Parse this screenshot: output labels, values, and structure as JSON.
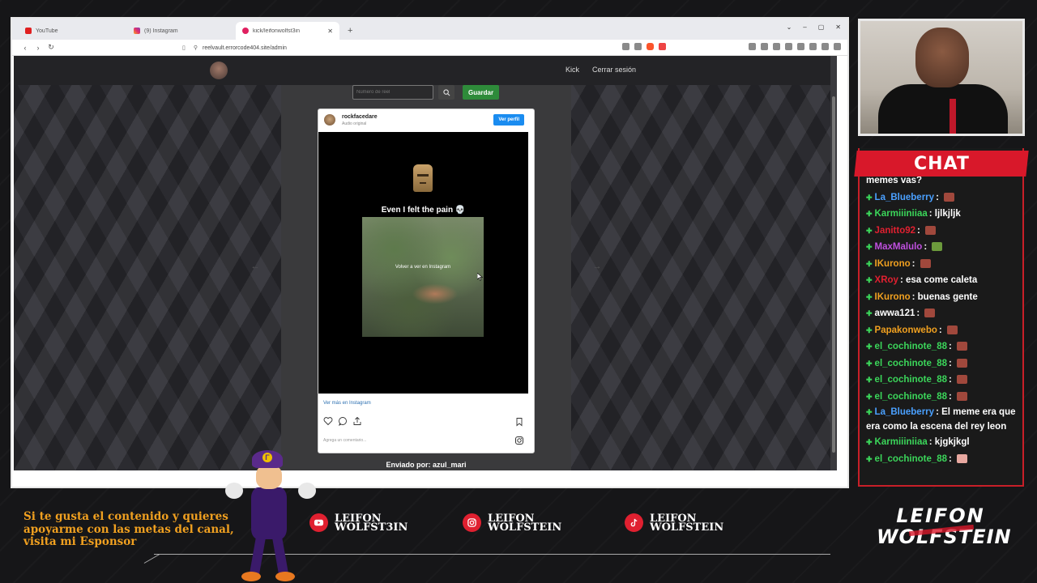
{
  "browser": {
    "tabs": [
      {
        "label": "YouTube",
        "favicon": "youtube-icon"
      },
      {
        "label": "(9) Instagram",
        "favicon": "instagram-icon"
      },
      {
        "label": "kick/leifonwolfst3in",
        "favicon": "kick-icon",
        "active": true
      }
    ],
    "new_tab_label": "+",
    "url": "reelvault.errorcode404.site/admin"
  },
  "site": {
    "nav": {
      "kick": "Kick",
      "logout": "Cerrar sesión"
    },
    "reel_input_placeholder": "Número de reel",
    "save_label": "Guardar",
    "sent_by": "Enviado por: azul_mari"
  },
  "instagram": {
    "username": "rockfacedare",
    "audio": "Audio original",
    "follow_label": "Ver perfil",
    "caption": "Even I felt the pain 💀",
    "video_overlay": "Volver a ver en Instagram",
    "more_label": "Ver más en Instagram",
    "comment_placeholder": "Agrega un comentario..."
  },
  "chat": {
    "title": "CHAT",
    "messages": [
      {
        "user": "",
        "text": "memes vas?",
        "color": "#ffffff"
      },
      {
        "user": "La_Blueberry",
        "text": "",
        "color": "#4aa0ff",
        "emote": "brick"
      },
      {
        "user": "Karmiiiniiaa",
        "text": "ljlkjljk",
        "color": "#3bd65a"
      },
      {
        "user": "Janitto92",
        "text": "",
        "color": "#e02030",
        "emote": "brick"
      },
      {
        "user": "MaxMalulo",
        "text": "",
        "color": "#c050e0",
        "emote": "green"
      },
      {
        "user": "IKurono",
        "text": "",
        "color": "#f0a020",
        "emote": "brick"
      },
      {
        "user": "XRoy",
        "text": "esa come caleta",
        "color": "#e02030"
      },
      {
        "user": "IKurono",
        "text": "buenas gente",
        "color": "#f0a020"
      },
      {
        "user": "awwa121",
        "text": "",
        "color": "#ffffff",
        "emote": "brick"
      },
      {
        "user": "Papakonwebo",
        "text": "",
        "color": "#f0a020",
        "emote": "brick"
      },
      {
        "user": "el_cochinote_88",
        "text": "",
        "color": "#3bd65a",
        "emote": "brick"
      },
      {
        "user": "el_cochinote_88",
        "text": "",
        "color": "#3bd65a",
        "emote": "brick"
      },
      {
        "user": "el_cochinote_88",
        "text": "",
        "color": "#3bd65a",
        "emote": "brick"
      },
      {
        "user": "el_cochinote_88",
        "text": "",
        "color": "#3bd65a",
        "emote": "brick"
      },
      {
        "user": "La_Blueberry",
        "text": "El meme era que era como la escena del rey leon",
        "color": "#4aa0ff"
      },
      {
        "user": "Karmiiiniiaa",
        "text": "kjgkjkgl",
        "color": "#3bd65a"
      },
      {
        "user": "el_cochinote_88",
        "text": "",
        "color": "#3bd65a",
        "emote": "pink"
      }
    ]
  },
  "overlay": {
    "sponsor_text": "Si te gusta el contenido y quieres apoyarme con las metas del canal, visita mi Esponsor",
    "youtube_handle": "LEIFON\nWOLFST3IN",
    "instagram_handle": "LEIFON\nWOLFSTEIN",
    "tiktok_handle": "LEIFON\nWOLFSTEIN",
    "logo_line1": "LEIFON",
    "logo_line2": "WOLFSTEIN"
  },
  "colors": {
    "accent": "#d8182a",
    "sponsor": "#f0a020",
    "save": "#2e8b3a",
    "follow": "#1a8cf0"
  }
}
